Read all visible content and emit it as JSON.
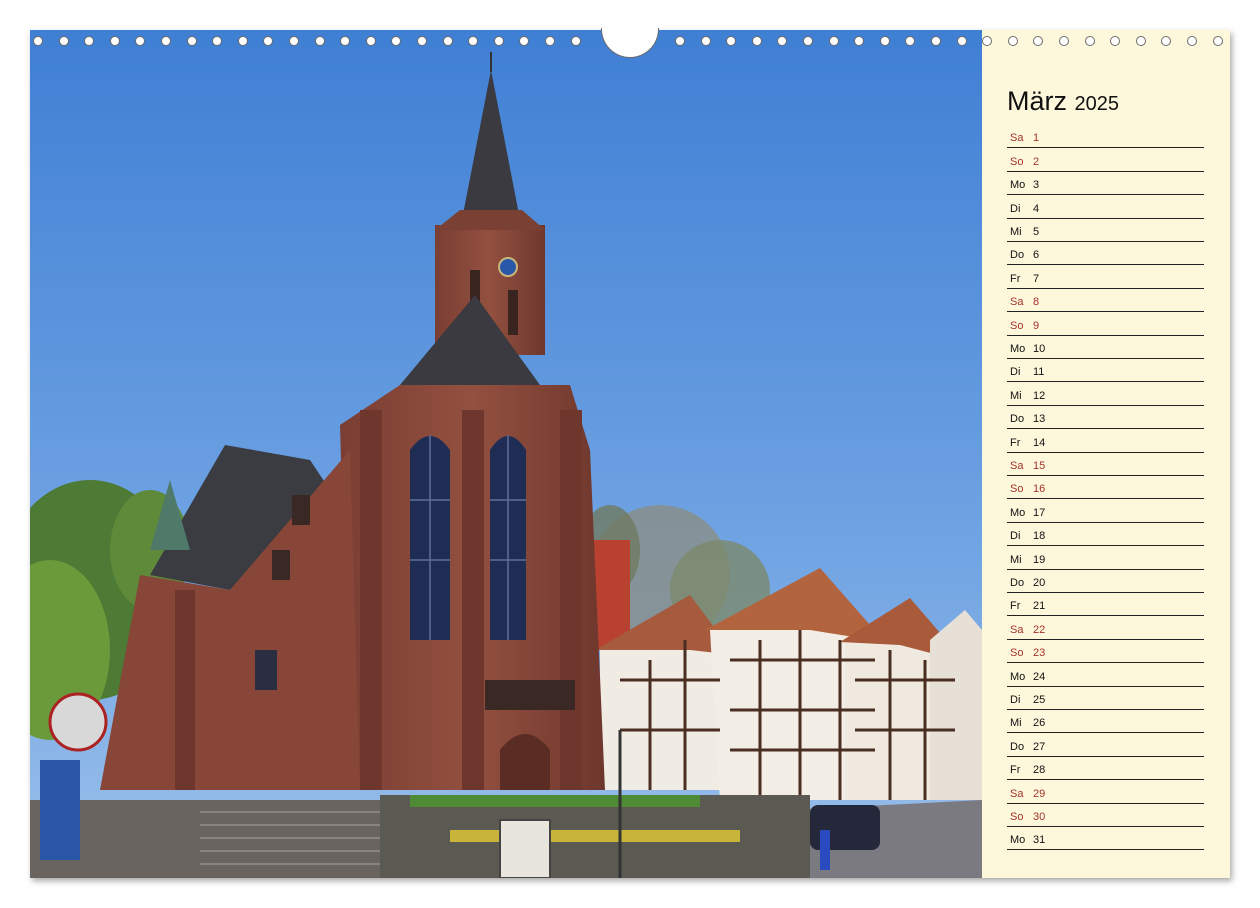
{
  "calendar": {
    "month": "März",
    "year": "2025",
    "days": [
      {
        "wd": "Sa",
        "d": "1",
        "weekend": true
      },
      {
        "wd": "So",
        "d": "2",
        "weekend": true
      },
      {
        "wd": "Mo",
        "d": "3",
        "weekend": false
      },
      {
        "wd": "Di",
        "d": "4",
        "weekend": false
      },
      {
        "wd": "Mi",
        "d": "5",
        "weekend": false
      },
      {
        "wd": "Do",
        "d": "6",
        "weekend": false
      },
      {
        "wd": "Fr",
        "d": "7",
        "weekend": false
      },
      {
        "wd": "Sa",
        "d": "8",
        "weekend": true
      },
      {
        "wd": "So",
        "d": "9",
        "weekend": true
      },
      {
        "wd": "Mo",
        "d": "10",
        "weekend": false
      },
      {
        "wd": "Di",
        "d": "11",
        "weekend": false
      },
      {
        "wd": "Mi",
        "d": "12",
        "weekend": false
      },
      {
        "wd": "Do",
        "d": "13",
        "weekend": false
      },
      {
        "wd": "Fr",
        "d": "14",
        "weekend": false
      },
      {
        "wd": "Sa",
        "d": "15",
        "weekend": true
      },
      {
        "wd": "So",
        "d": "16",
        "weekend": true
      },
      {
        "wd": "Mo",
        "d": "17",
        "weekend": false
      },
      {
        "wd": "Di",
        "d": "18",
        "weekend": false
      },
      {
        "wd": "Mi",
        "d": "19",
        "weekend": false
      },
      {
        "wd": "Do",
        "d": "20",
        "weekend": false
      },
      {
        "wd": "Fr",
        "d": "21",
        "weekend": false
      },
      {
        "wd": "Sa",
        "d": "22",
        "weekend": true
      },
      {
        "wd": "So",
        "d": "23",
        "weekend": true
      },
      {
        "wd": "Mo",
        "d": "24",
        "weekend": false
      },
      {
        "wd": "Di",
        "d": "25",
        "weekend": false
      },
      {
        "wd": "Mi",
        "d": "26",
        "weekend": false
      },
      {
        "wd": "Do",
        "d": "27",
        "weekend": false
      },
      {
        "wd": "Fr",
        "d": "28",
        "weekend": false
      },
      {
        "wd": "Sa",
        "d": "29",
        "weekend": true
      },
      {
        "wd": "So",
        "d": "30",
        "weekend": true
      },
      {
        "wd": "Mo",
        "d": "31",
        "weekend": false
      }
    ]
  },
  "colors": {
    "paper": "#fdf8dc",
    "weekend_text": "#a3322a",
    "weekday_text": "#111111",
    "sky": "#4a86d6",
    "sandstone": "#8c4a3c"
  }
}
